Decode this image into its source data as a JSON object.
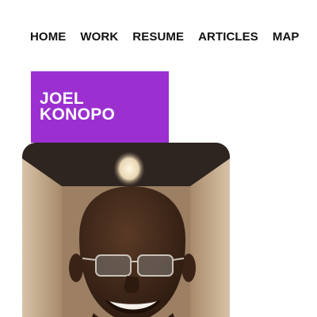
{
  "nav": {
    "items": [
      {
        "label": "HOME"
      },
      {
        "label": "WORK"
      },
      {
        "label": "RESUME"
      },
      {
        "label": "ARTICLES"
      },
      {
        "label": "MAP"
      }
    ]
  },
  "profile": {
    "name_line1": "JOEL",
    "name_line2": "KONOPO",
    "accent_color": "#9b2fd0",
    "photo_icon": "portrait-photo"
  }
}
